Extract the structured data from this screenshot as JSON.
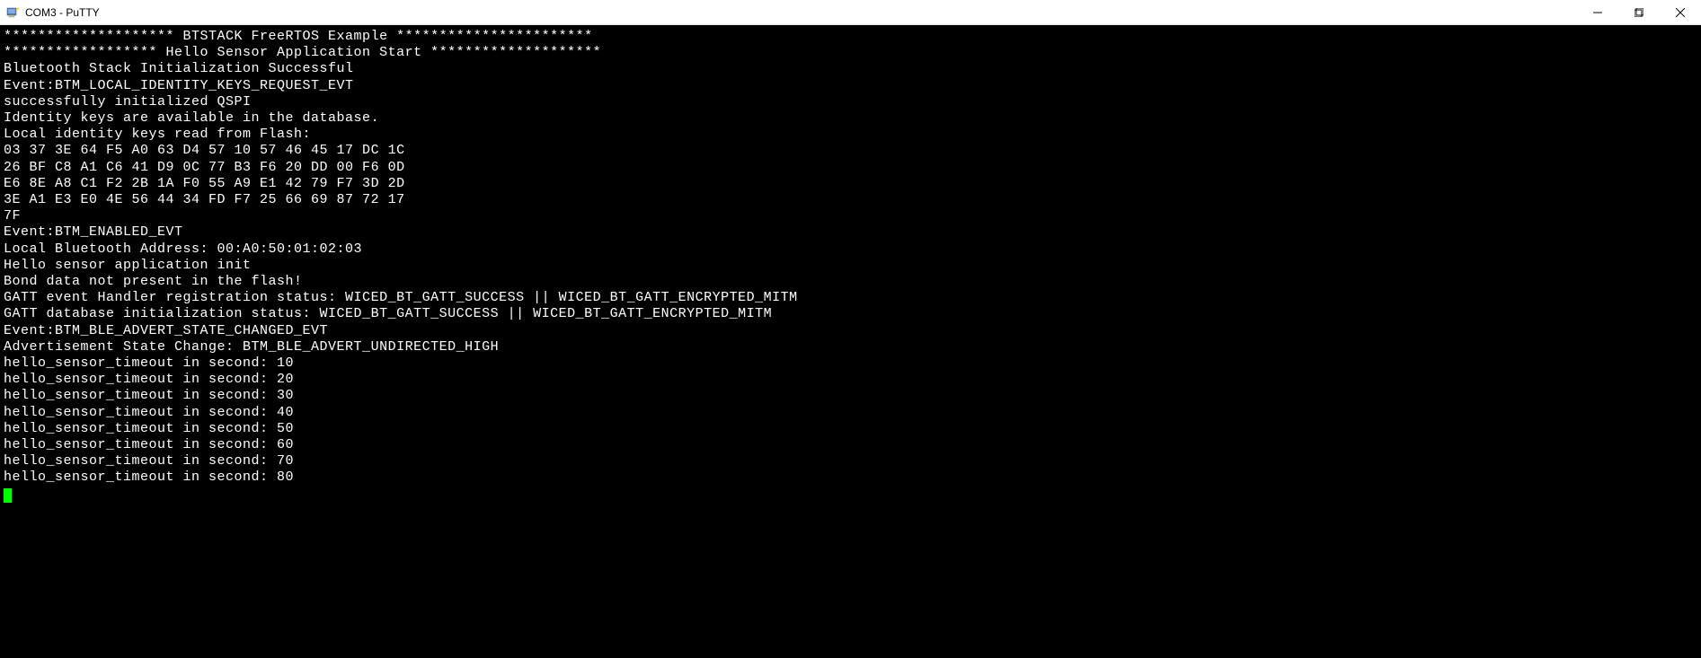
{
  "window": {
    "title": "COM3 - PuTTY"
  },
  "terminal": {
    "lines": [
      "******************** BTSTACK FreeRTOS Example ***********************",
      "****************** Hello Sensor Application Start ********************",
      "Bluetooth Stack Initialization Successful",
      "Event:BTM_LOCAL_IDENTITY_KEYS_REQUEST_EVT",
      "successfully initialized QSPI",
      "Identity keys are available in the database.",
      "Local identity keys read from Flash:",
      "",
      "03 37 3E 64 F5 A0 63 D4 57 10 57 46 45 17 DC 1C",
      "26 BF C8 A1 C6 41 D9 0C 77 B3 F6 20 DD 00 F6 0D",
      "E6 8E A8 C1 F2 2B 1A F0 55 A9 E1 42 79 F7 3D 2D",
      "3E A1 E3 E0 4E 56 44 34 FD F7 25 66 69 87 72 17",
      "7F",
      "Event:BTM_ENABLED_EVT",
      "Local Bluetooth Address: 00:A0:50:01:02:03",
      "",
      "Hello sensor application init",
      "Bond data not present in the flash!",
      "GATT event Handler registration status: WICED_BT_GATT_SUCCESS || WICED_BT_GATT_ENCRYPTED_MITM",
      "GATT database initialization status: WICED_BT_GATT_SUCCESS || WICED_BT_GATT_ENCRYPTED_MITM",
      "Event:BTM_BLE_ADVERT_STATE_CHANGED_EVT",
      "Advertisement State Change: BTM_BLE_ADVERT_UNDIRECTED_HIGH",
      "hello_sensor_timeout in second: 10",
      "hello_sensor_timeout in second: 20",
      "hello_sensor_timeout in second: 30",
      "hello_sensor_timeout in second: 40",
      "hello_sensor_timeout in second: 50",
      "hello_sensor_timeout in second: 60",
      "hello_sensor_timeout in second: 70",
      "hello_sensor_timeout in second: 80"
    ]
  }
}
